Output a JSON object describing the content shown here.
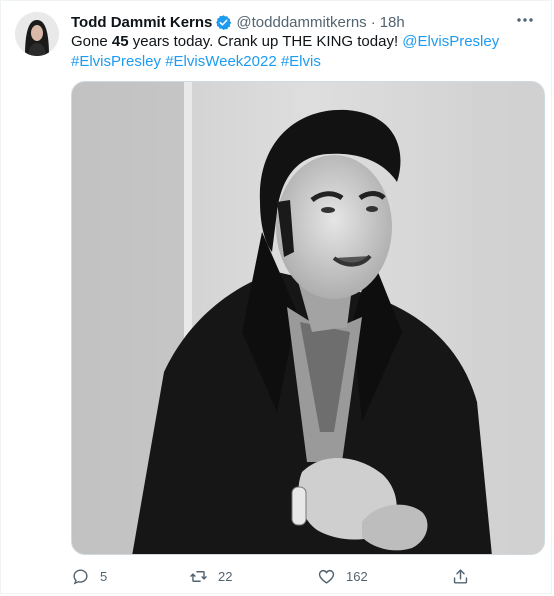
{
  "tweet": {
    "author": {
      "name": "Todd Dammit Kerns",
      "handle": "@todddammitkerns",
      "verified": true,
      "avatar_icon": "user-avatar"
    },
    "separator": "·",
    "time": "18h",
    "text": {
      "part1": "Gone ",
      "bold_number": "45",
      "part2": " years today. Crank up THE KING today! ",
      "mention": "@ElvisPresley",
      "hashtags": [
        "#ElvisPresley",
        "#ElvisWeek2022",
        "#Elvis"
      ]
    },
    "media": {
      "alt": "Black and white photo of Elvis Presley in a dark high-collared jacket"
    },
    "actions": {
      "replies": "5",
      "retweets": "22",
      "likes": "162"
    },
    "colors": {
      "link": "#1d9bf0",
      "secondary_text": "#536471",
      "verified": "#1d9bf0"
    }
  }
}
